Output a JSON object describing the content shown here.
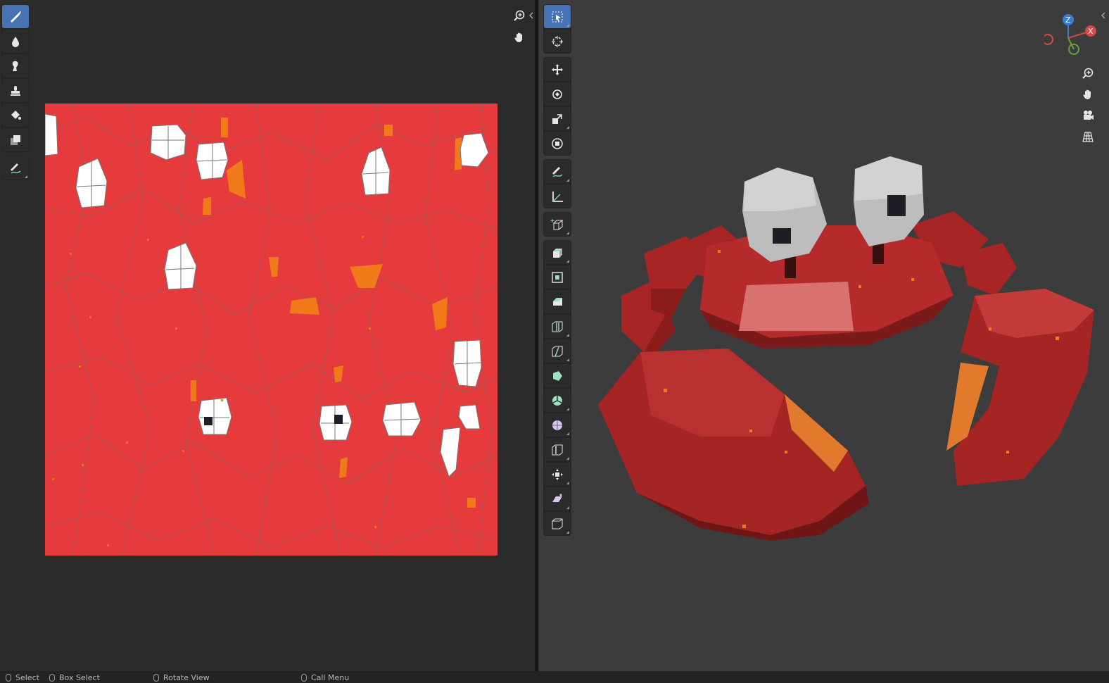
{
  "status_bar": {
    "select": "Select",
    "box_select": "Box Select",
    "rotate_view": "Rotate View",
    "call_menu": "Call Menu"
  },
  "image_editor": {
    "tools": [
      "draw-brush",
      "soften",
      "smear",
      "clone",
      "fill",
      "mask",
      "annotate"
    ],
    "active_tool": "draw-brush"
  },
  "viewport_3d": {
    "tools": [
      "select-box",
      "cursor",
      "move",
      "rotate",
      "scale",
      "transform",
      "annotate",
      "measure",
      "add-cube",
      "extrude-region",
      "inset-faces",
      "bevel",
      "loop-cut",
      "knife",
      "poly-build",
      "spin",
      "smooth",
      "edge-slide",
      "shrink-fatten",
      "shear",
      "rip-region"
    ],
    "active_tool": "select-box",
    "gizmo_axes": [
      "Z",
      "X"
    ]
  },
  "colors": {
    "accent": "#4772b3",
    "texture_red": "#e33c3c",
    "texture_orange": "#f07a1a",
    "crab_red": "#b52a2a",
    "eye_gray": "#bdbdbd"
  }
}
